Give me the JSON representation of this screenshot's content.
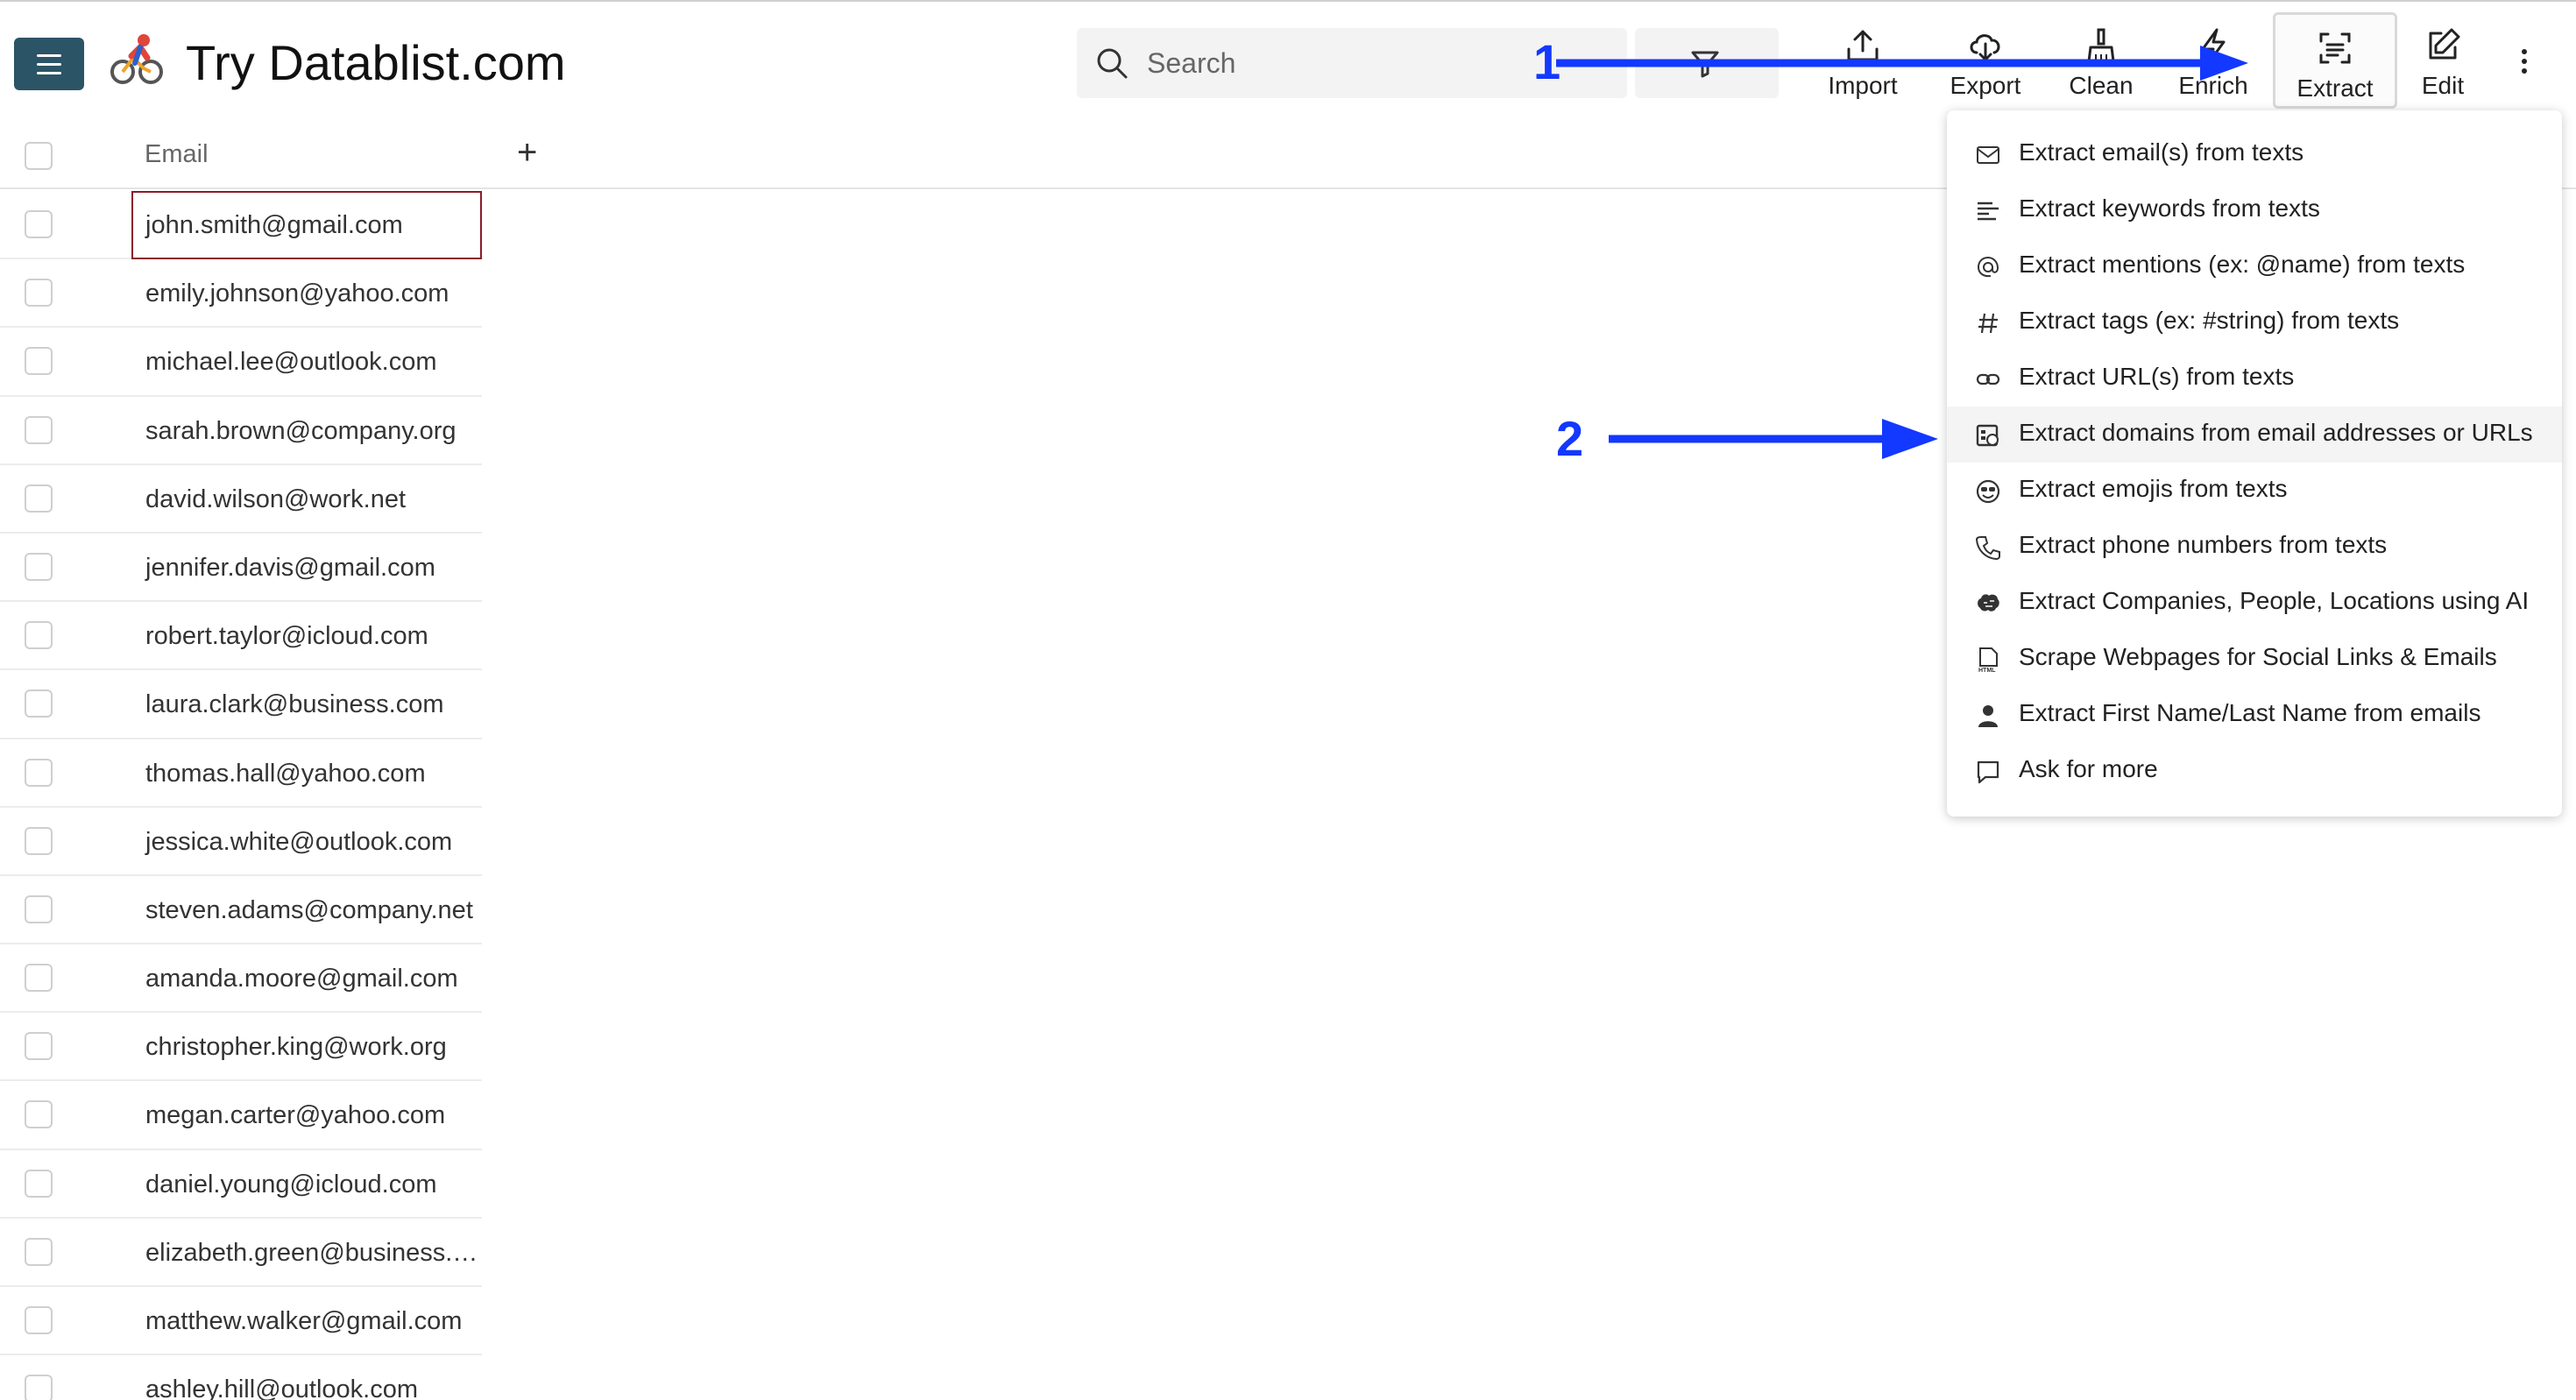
{
  "header": {
    "title": "Try Datablist.com",
    "search_placeholder": "Search",
    "toolbar": [
      {
        "label": "Import",
        "icon": "upload-icon"
      },
      {
        "label": "Export",
        "icon": "cloud-download-icon"
      },
      {
        "label": "Clean",
        "icon": "broom-icon"
      },
      {
        "label": "Enrich",
        "icon": "lightning-icon"
      },
      {
        "label": "Extract",
        "icon": "extract-scan-icon",
        "active": true
      },
      {
        "label": "Edit",
        "icon": "edit-icon"
      }
    ]
  },
  "table": {
    "column": "Email",
    "rows": [
      "john.smith@gmail.com",
      "emily.johnson@yahoo.com",
      "michael.lee@outlook.com",
      "sarah.brown@company.org",
      "david.wilson@work.net",
      "jennifer.davis@gmail.com",
      "robert.taylor@icloud.com",
      "laura.clark@business.com",
      "thomas.hall@yahoo.com",
      "jessica.white@outlook.com",
      "steven.adams@company.net",
      "amanda.moore@gmail.com",
      "christopher.king@work.org",
      "megan.carter@yahoo.com",
      "daniel.young@icloud.com",
      "elizabeth.green@business.com",
      "matthew.walker@gmail.com",
      "ashley.hill@outlook.com"
    ]
  },
  "extract_menu": {
    "items": [
      {
        "label": "Extract email(s) from texts",
        "icon": "envelope-icon"
      },
      {
        "label": "Extract keywords from texts",
        "icon": "keywords-icon"
      },
      {
        "label": "Extract mentions (ex: @name) from texts",
        "icon": "at-sign-icon"
      },
      {
        "label": "Extract tags (ex: #string) from texts",
        "icon": "hashtag-icon"
      },
      {
        "label": "Extract URL(s) from texts",
        "icon": "link-icon"
      },
      {
        "label": "Extract domains from email addresses or URLs",
        "icon": "domain-icon",
        "highlighted": true
      },
      {
        "label": "Extract emojis from texts",
        "icon": "emoji-icon"
      },
      {
        "label": "Extract phone numbers from texts",
        "icon": "phone-icon"
      },
      {
        "label": "Extract Companies, People, Locations using AI",
        "icon": "brain-icon"
      },
      {
        "label": "Scrape Webpages for Social Links & Emails",
        "icon": "html-file-icon"
      },
      {
        "label": "Extract First Name/Last Name from emails",
        "icon": "person-icon"
      },
      {
        "label": "Ask for more",
        "icon": "chat-bubble-icon"
      }
    ]
  },
  "annotations": {
    "step1": "1",
    "step2": "2",
    "color": "#1338ff"
  }
}
